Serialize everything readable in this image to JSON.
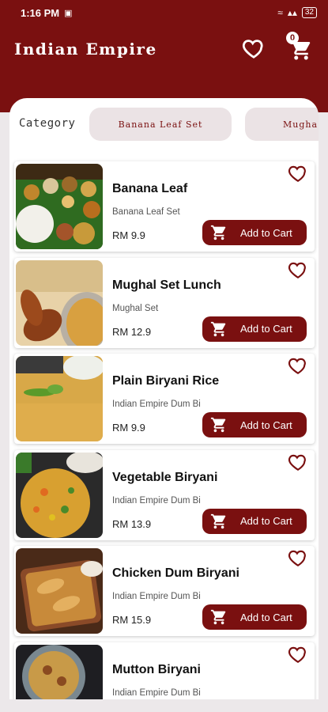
{
  "status": {
    "time": "1:16 PM",
    "battery": "32"
  },
  "app": {
    "title": "Indian Empire",
    "cart_count": "0"
  },
  "category": {
    "label": "Category",
    "chips": [
      "Banana Leaf Set",
      "Mugha"
    ]
  },
  "items": [
    {
      "name": "Banana Leaf",
      "sub": "Banana Leaf Set",
      "price": "RM 9.9",
      "button": "Add to Cart",
      "thumb": "banana-leaf-meal"
    },
    {
      "name": "Mughal Set Lunch",
      "sub": "Mughal Set",
      "price": "RM 12.9",
      "button": "Add to Cart",
      "thumb": "chicken-drumsticks"
    },
    {
      "name": "Plain Biryani Rice",
      "sub": "Indian Empire Dum Bi",
      "price": "RM 9.9",
      "button": "Add to Cart",
      "thumb": "plain-biryani"
    },
    {
      "name": "Vegetable Biryani",
      "sub": "Indian Empire Dum Bi",
      "price": "RM 13.9",
      "button": "Add to Cart",
      "thumb": "vegetable-biryani"
    },
    {
      "name": "Chicken Dum Biryani",
      "sub": "Indian Empire Dum Bi",
      "price": "RM 15.9",
      "button": "Add to Cart",
      "thumb": "chicken-biryani"
    },
    {
      "name": "Mutton Biryani",
      "sub": "Indian Empire Dum Bi",
      "price": "",
      "button": "",
      "thumb": "mutton-biryani"
    }
  ],
  "colors": {
    "brand": "#7a1010",
    "chip_bg": "#ebe3e5",
    "page_bg": "#ece8ea"
  }
}
